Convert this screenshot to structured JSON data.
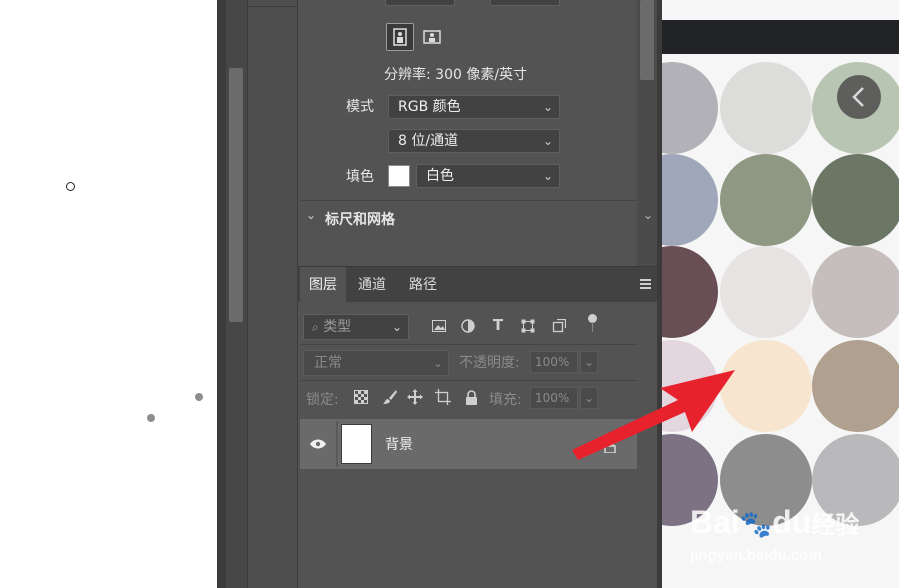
{
  "new_doc": {
    "resolution_text": "分辨率: 300 像素/英寸",
    "mode_label": "模式",
    "mode_value": "RGB 颜色",
    "bit_depth_value": "8 位/通道",
    "fill_label": "填色",
    "fill_value": "白色",
    "section_ruler_grid": "标尺和网格"
  },
  "layers_panel": {
    "tabs": [
      "图层",
      "通道",
      "路径"
    ],
    "active_tab": "图层",
    "filter_placeholder": "类型",
    "blend_mode": "正常",
    "opacity_label": "不透明度:",
    "opacity_value": "100%",
    "lock_label": "锁定:",
    "fill_label": "填充:",
    "fill_value": "100%",
    "layers": [
      {
        "name": "背景",
        "visible": true,
        "locked": true
      }
    ]
  },
  "image": {
    "watermark_brand": "Bai",
    "watermark_paw": "🐾",
    "watermark_du": "du",
    "watermark_jy": "经验",
    "watermark_url": "jingyan.baidu.com",
    "swatch_colors": [
      "#b2b1b7",
      "#dcdddb",
      "#b9c5b3",
      "#a0a7ba",
      "#8f9883",
      "#6b7665",
      "#694f55",
      "#e8e3e3",
      "#c5bebd",
      "#e4d6de",
      "#f7e5cf",
      "#b0a08f",
      "#7d7283",
      "#8d8d8d",
      "#b9b8bb"
    ],
    "arrow_color": "#e8222c"
  }
}
